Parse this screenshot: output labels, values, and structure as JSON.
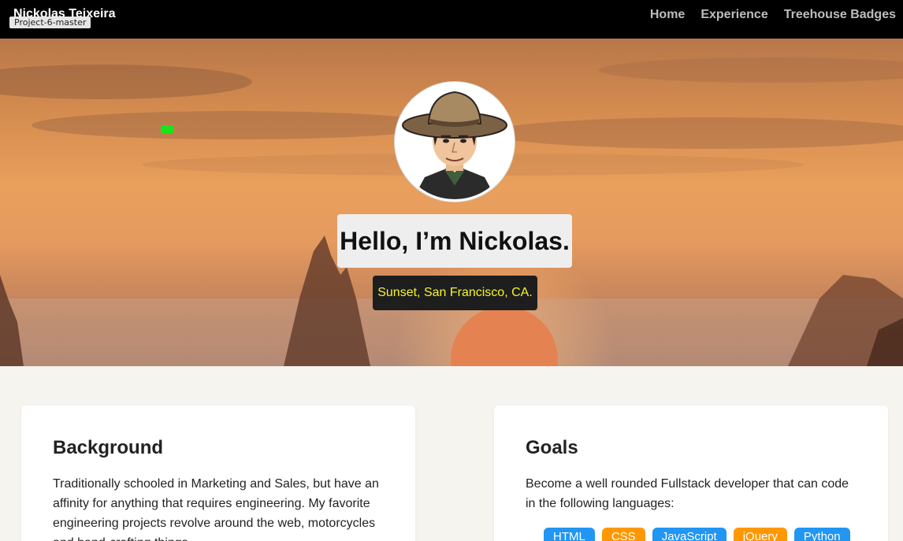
{
  "window": {
    "tooltip_label": "Project-6-master"
  },
  "navbar": {
    "brand": "Nickolas Teixeira",
    "links": [
      "Home",
      "Experience",
      "Treehouse Badges"
    ]
  },
  "hero": {
    "greeting": "Hello, I’m Nickolas.",
    "caption": "Sunset, San Francisco, CA."
  },
  "background": {
    "title": "Background",
    "text": "Traditionally schooled in Marketing and Sales, but have an affinity for anything that requires engineering. My favorite engineering projects revolve around the web, motorcycles and hand-crafting things"
  },
  "goals": {
    "title": "Goals",
    "text": "Become a well rounded Fullstack developer that can code in the following languages:",
    "badges": [
      {
        "label": "HTML",
        "color": "#2196f3"
      },
      {
        "label": "CSS",
        "color": "#ff9800"
      },
      {
        "label": "JavaScript",
        "color": "#2196f3"
      },
      {
        "label": "jQuery",
        "color": "#ff9800"
      },
      {
        "label": "Python",
        "color": "#2196f3"
      }
    ]
  },
  "colors": {
    "navbar_bg": "#000000",
    "caption_text": "#f5f52a",
    "page_bg": "#f5f4ef"
  }
}
